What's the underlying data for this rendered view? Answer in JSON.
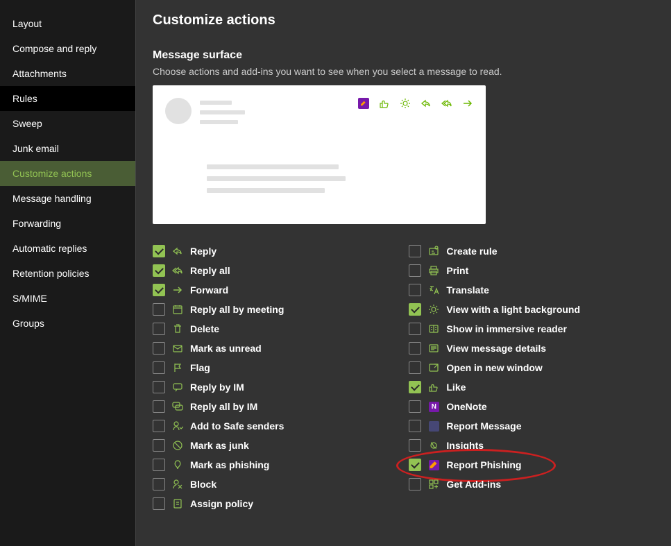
{
  "colors": {
    "accent": "#92c353",
    "bg": "#333333",
    "sidebar": "#1a1a1a"
  },
  "sidebar": {
    "items": [
      {
        "label": "Layout",
        "selected": false,
        "dark": false
      },
      {
        "label": "Compose and reply",
        "selected": false,
        "dark": false
      },
      {
        "label": "Attachments",
        "selected": false,
        "dark": false
      },
      {
        "label": "Rules",
        "selected": false,
        "dark": true
      },
      {
        "label": "Sweep",
        "selected": false,
        "dark": false
      },
      {
        "label": "Junk email",
        "selected": false,
        "dark": false
      },
      {
        "label": "Customize actions",
        "selected": true,
        "dark": false
      },
      {
        "label": "Message handling",
        "selected": false,
        "dark": false
      },
      {
        "label": "Forwarding",
        "selected": false,
        "dark": false
      },
      {
        "label": "Automatic replies",
        "selected": false,
        "dark": false
      },
      {
        "label": "Retention policies",
        "selected": false,
        "dark": false
      },
      {
        "label": "S/MIME",
        "selected": false,
        "dark": false
      },
      {
        "label": "Groups",
        "selected": false,
        "dark": false
      }
    ]
  },
  "page": {
    "title": "Customize actions",
    "section_title": "Message surface",
    "section_desc": "Choose actions and add-ins you want to see when you select a message to read."
  },
  "actions_left": [
    {
      "label": "Reply",
      "checked": true,
      "icon": "reply"
    },
    {
      "label": "Reply all",
      "checked": true,
      "icon": "replyall"
    },
    {
      "label": "Forward",
      "checked": true,
      "icon": "forward"
    },
    {
      "label": "Reply all by meeting",
      "checked": false,
      "icon": "calendar"
    },
    {
      "label": "Delete",
      "checked": false,
      "icon": "trash"
    },
    {
      "label": "Mark as unread",
      "checked": false,
      "icon": "mail"
    },
    {
      "label": "Flag",
      "checked": false,
      "icon": "flag"
    },
    {
      "label": "Reply by IM",
      "checked": false,
      "icon": "chat"
    },
    {
      "label": "Reply all by IM",
      "checked": false,
      "icon": "chatall"
    },
    {
      "label": "Add to Safe senders",
      "checked": false,
      "icon": "safesender"
    },
    {
      "label": "Mark as junk",
      "checked": false,
      "icon": "junk"
    },
    {
      "label": "Mark as phishing",
      "checked": false,
      "icon": "phishing"
    },
    {
      "label": "Block",
      "checked": false,
      "icon": "block"
    },
    {
      "label": "Assign policy",
      "checked": false,
      "icon": "policy"
    }
  ],
  "actions_right": [
    {
      "label": "Create rule",
      "checked": false,
      "icon": "rule"
    },
    {
      "label": "Print",
      "checked": false,
      "icon": "print"
    },
    {
      "label": "Translate",
      "checked": false,
      "icon": "translate"
    },
    {
      "label": "View with a light background",
      "checked": true,
      "icon": "sun"
    },
    {
      "label": "Show in immersive reader",
      "checked": false,
      "icon": "reader"
    },
    {
      "label": "View message details",
      "checked": false,
      "icon": "details"
    },
    {
      "label": "Open in new window",
      "checked": false,
      "icon": "window"
    },
    {
      "label": "Like",
      "checked": true,
      "icon": "like"
    },
    {
      "label": "OneNote",
      "checked": false,
      "icon": "onenote"
    },
    {
      "label": "Report Message",
      "checked": false,
      "icon": "reportmsg"
    },
    {
      "label": "Insights",
      "checked": false,
      "icon": "insights"
    },
    {
      "label": "Report Phishing",
      "checked": true,
      "icon": "reportphish",
      "highlighted": true
    },
    {
      "label": "Get Add-ins",
      "checked": false,
      "icon": "addins"
    }
  ]
}
